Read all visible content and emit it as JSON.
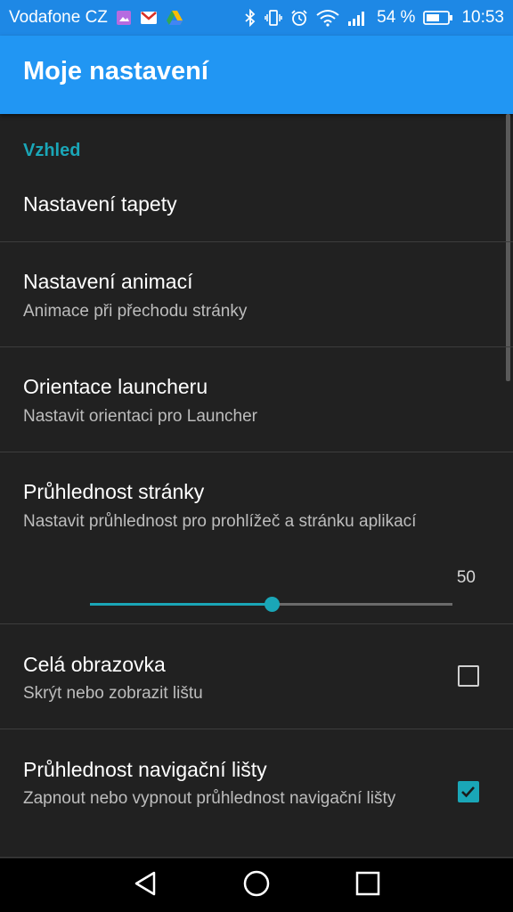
{
  "status_bar": {
    "carrier": "Vodafone CZ",
    "battery_percent": "54 %",
    "time": "10:53",
    "icons_left": [
      "gallery-icon",
      "gmail-icon",
      "drive-icon"
    ],
    "icons_right": [
      "bluetooth-icon",
      "vibrate-icon",
      "alarm-icon",
      "wifi-icon",
      "signal-icon",
      "battery-icon"
    ]
  },
  "app_bar": {
    "title": "Moje nastavení",
    "background": "#2196f3"
  },
  "category": {
    "label": "Vzhled",
    "color": "#1aa6b7"
  },
  "preferences": {
    "wallpaper": {
      "title": "Nastavení tapety"
    },
    "animation": {
      "title": "Nastavení animací",
      "summary": "Animace při přechodu stránky"
    },
    "orientation": {
      "title": "Orientace launcheru",
      "summary": "Nastavit orientaci pro Launcher"
    },
    "transparency": {
      "title": "Průhlednost stránky",
      "summary": "Nastavit průhlednost pro prohlížeč a stránku aplikací",
      "slider_value": "50",
      "slider_fraction": 0.5
    },
    "fullscreen": {
      "title": "Celá obrazovka",
      "summary": "Skrýt nebo zobrazit lištu",
      "checked": false
    },
    "nav_transparency": {
      "title": "Průhlednost navigační lišty",
      "summary": "Zapnout nebo vypnout průhlednost navigační lišty",
      "checked": true
    }
  },
  "nav_bar": {
    "buttons": [
      "back-icon",
      "home-icon",
      "recents-icon"
    ]
  }
}
